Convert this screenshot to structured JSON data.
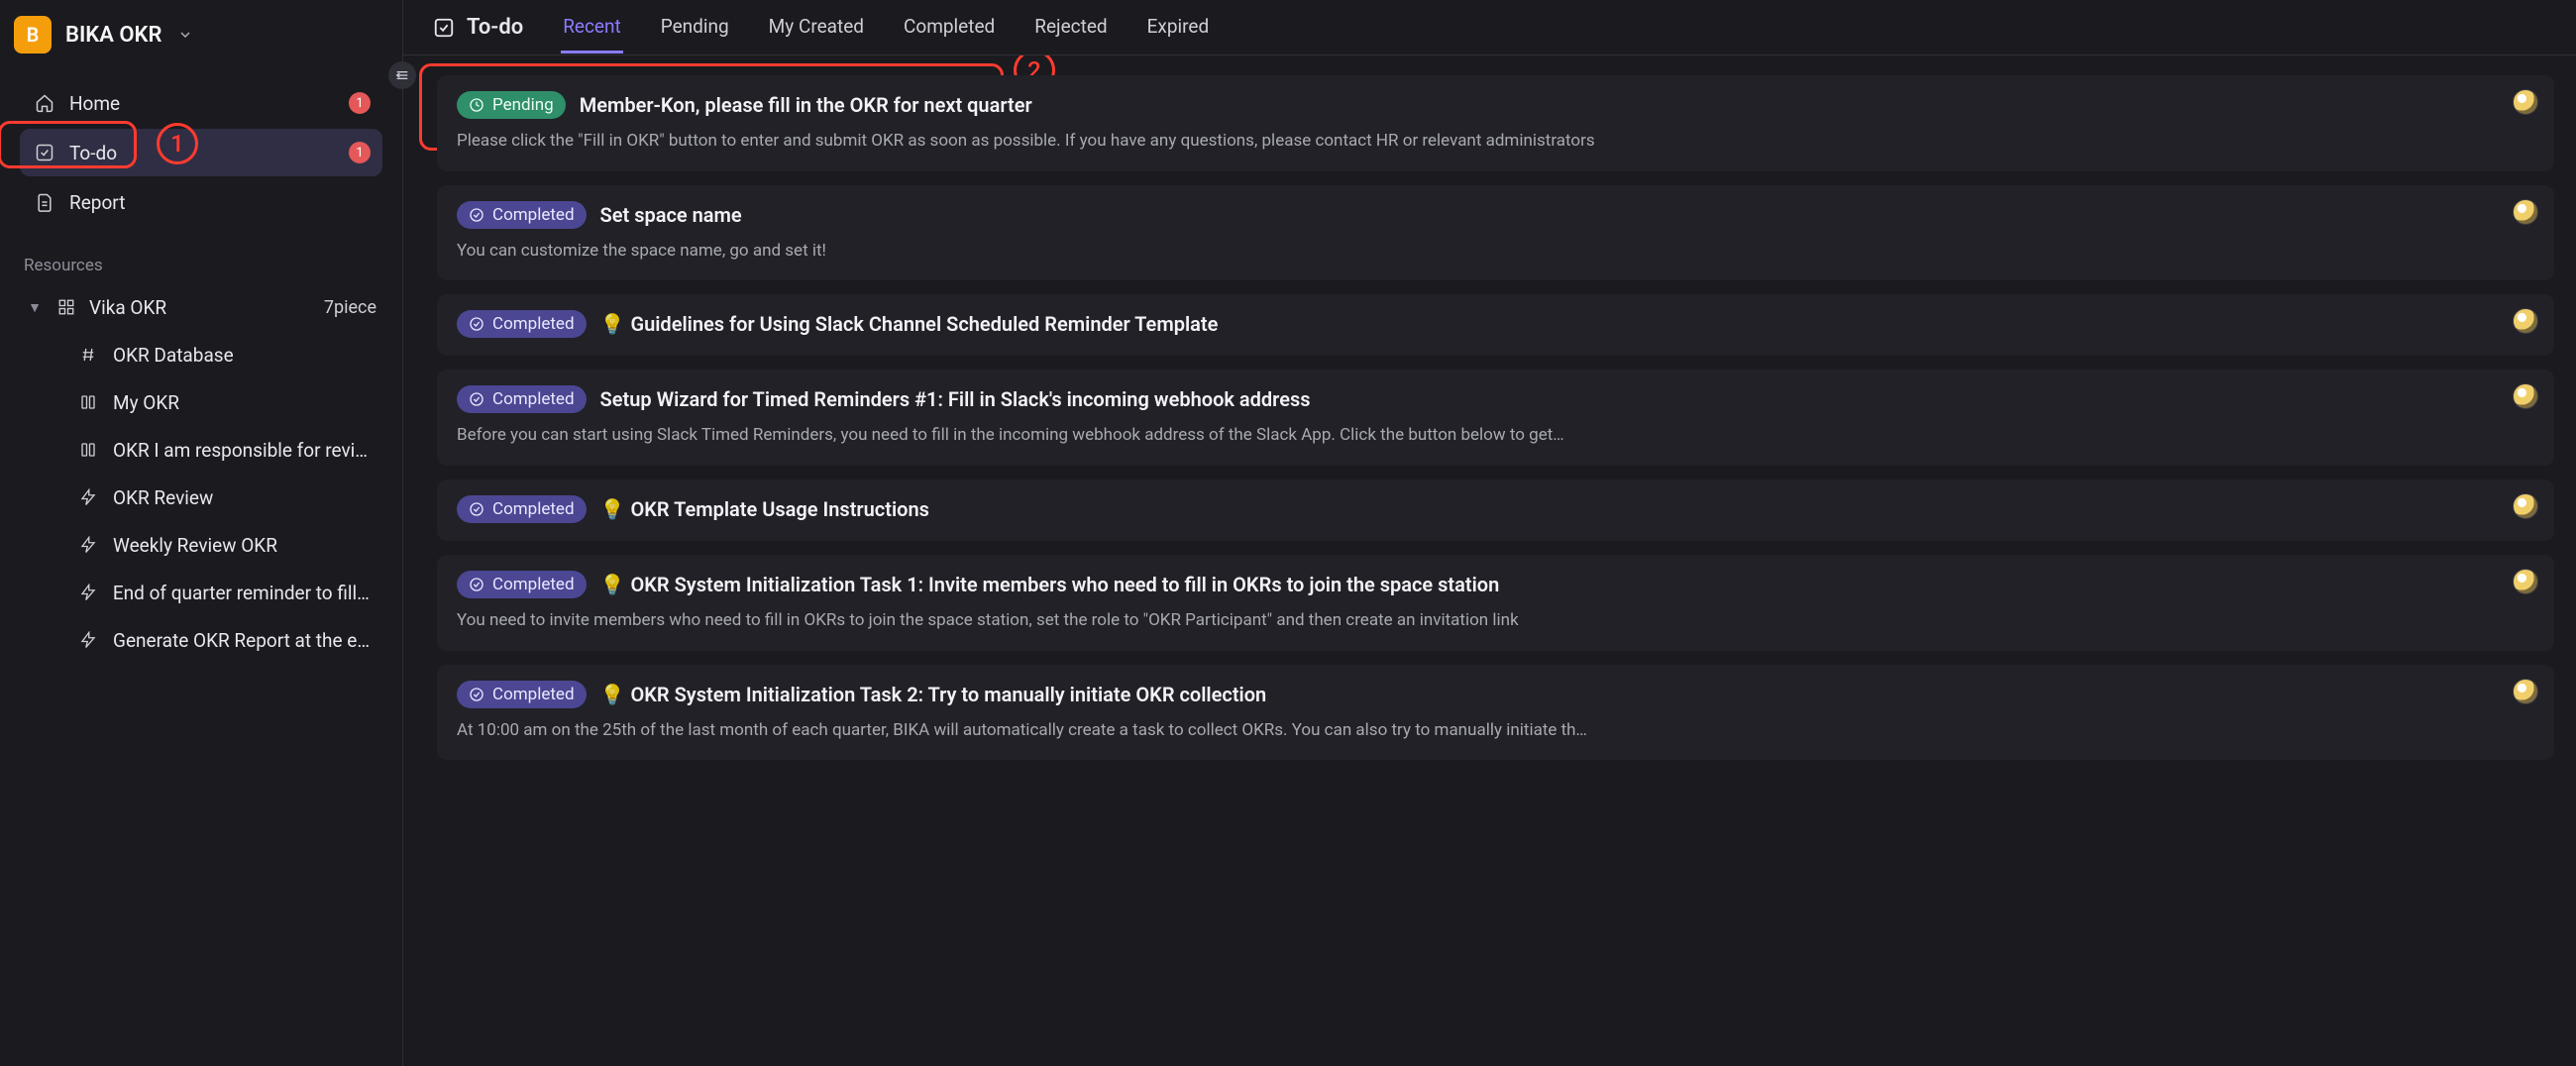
{
  "brand": {
    "logo_letter": "B",
    "title": "BIKA OKR"
  },
  "sidebar": {
    "nav": [
      {
        "key": "home",
        "label": "Home",
        "badge": "1"
      },
      {
        "key": "todo",
        "label": "To-do",
        "badge": "1",
        "active": true
      },
      {
        "key": "report",
        "label": "Report",
        "badge": ""
      }
    ],
    "resources_label": "Resources",
    "tree": {
      "title": "Vika OKR",
      "count": "7piece",
      "children": [
        {
          "icon": "hash",
          "label": "OKR Database"
        },
        {
          "icon": "columns",
          "label": "My OKR"
        },
        {
          "icon": "columns",
          "label": "OKR I am responsible for revi…"
        },
        {
          "icon": "bolt",
          "label": "OKR Review"
        },
        {
          "icon": "bolt",
          "label": "Weekly Review OKR"
        },
        {
          "icon": "bolt",
          "label": "End of quarter reminder to fill …"
        },
        {
          "icon": "bolt",
          "label": "Generate OKR Report at the e…"
        }
      ]
    }
  },
  "tabs": {
    "title": "To-do",
    "items": [
      {
        "label": "Recent",
        "active": true
      },
      {
        "label": "Pending"
      },
      {
        "label": "My Created"
      },
      {
        "label": "Completed"
      },
      {
        "label": "Rejected"
      },
      {
        "label": "Expired"
      }
    ]
  },
  "tasks": [
    {
      "status": "Pending",
      "title": "Member-Kon, please fill in the OKR for next quarter",
      "desc": "Please click the \"Fill in OKR\" button to enter and submit OKR as soon as possible. If you have any questions, please contact HR or relevant administrators"
    },
    {
      "status": "Completed",
      "title": "Set space name",
      "desc": "You can customize the space name, go and set it!"
    },
    {
      "status": "Completed",
      "bulb": true,
      "title": "Guidelines for Using Slack Channel Scheduled Reminder Template",
      "desc": ""
    },
    {
      "status": "Completed",
      "title": "Setup Wizard for Timed Reminders #1: Fill in Slack's incoming webhook address",
      "desc": "Before you can start using Slack Timed Reminders, you need to fill in the incoming webhook address of the Slack App. Click the button below to get…"
    },
    {
      "status": "Completed",
      "bulb": true,
      "title": "OKR Template Usage Instructions",
      "desc": ""
    },
    {
      "status": "Completed",
      "bulb": true,
      "title": "OKR System Initialization Task 1: Invite members who need to fill in OKRs to join the space station",
      "desc": "You need to invite members who need to fill in OKRs to join the space station, set the role to \"OKR Participant\" and then create an invitation link"
    },
    {
      "status": "Completed",
      "bulb": true,
      "title": "OKR System Initialization Task 2: Try to manually initiate OKR collection",
      "desc": "At 10:00 am on the 25th of the last month of each quarter, BIKA will automatically create a task to collect OKRs. You can also try to manually initiate th…"
    }
  ],
  "annotations": {
    "one": "1",
    "two": "2"
  }
}
